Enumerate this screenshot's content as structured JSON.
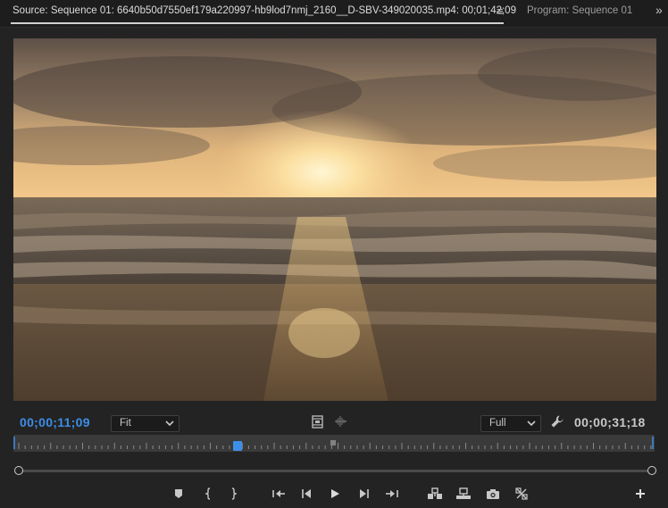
{
  "tabs": {
    "source_label": "Source: Sequence 01: 6640b50d7550ef179a220997-hb9lod7nmj_2160__D-SBV-349020035.mp4: 00;01;42;09",
    "menu_glyph": "≡",
    "program_label": "Program: Sequence 01",
    "overflow_glyph": "»"
  },
  "viewer": {
    "content": "sunset-over-ocean-beach-frame"
  },
  "controls": {
    "current_timecode": "00;00;11;09",
    "duration_timecode": "00;00;31;18",
    "zoom_value": "Fit",
    "resolution_value": "Full",
    "playhead_position": 0.35
  },
  "colors": {
    "accent": "#3d8ee8",
    "panel_bg": "#232323",
    "tab_bg": "#1d1d1d",
    "ruler_bg": "#3a3a3a"
  },
  "transport_icons": [
    "add-marker-icon",
    "mark-in-icon",
    "mark-out-icon",
    "go-to-in-icon",
    "step-back-icon",
    "play-icon",
    "step-forward-icon",
    "go-to-out-icon",
    "insert-icon",
    "overwrite-icon",
    "export-frame-icon",
    "button-editor-icon",
    "add-button-icon"
  ]
}
